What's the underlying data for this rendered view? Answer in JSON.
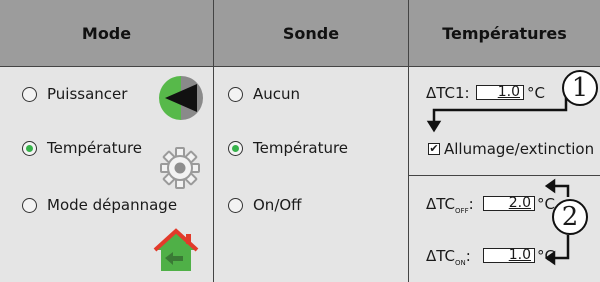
{
  "headers": {
    "mode": "Mode",
    "sonde": "Sonde",
    "temperatures": "Températures"
  },
  "mode_options": [
    {
      "label": "Puissancer",
      "selected": false
    },
    {
      "label": "Température",
      "selected": true
    },
    {
      "label": "Mode dépannage",
      "selected": false
    }
  ],
  "sonde_options": [
    {
      "label": "Aucun",
      "selected": false
    },
    {
      "label": "Température",
      "selected": true
    },
    {
      "label": "On/Off",
      "selected": false
    }
  ],
  "temps": {
    "tc1_label": "ΔTC1:",
    "tc1_value": "1.0",
    "unit": "°C",
    "checkbox_label": "Allumage/extinction",
    "checkbox_checked": true,
    "tc_prefix": "ΔTC",
    "tc_off_sub": "OFF",
    "tc_off_value": "2.0",
    "tc_on_sub": "ON",
    "tc_on_value": "1.0"
  },
  "callouts": [
    "1",
    "2"
  ],
  "colors": {
    "header_bg": "#9c9c9c",
    "panel_bg": "#e5e5e5",
    "radio_selected": "#36b24a"
  },
  "icons": {
    "puissance": "green-back-arrow-icon",
    "temperature": "gear-icon",
    "depannage": "house-back-icon"
  }
}
